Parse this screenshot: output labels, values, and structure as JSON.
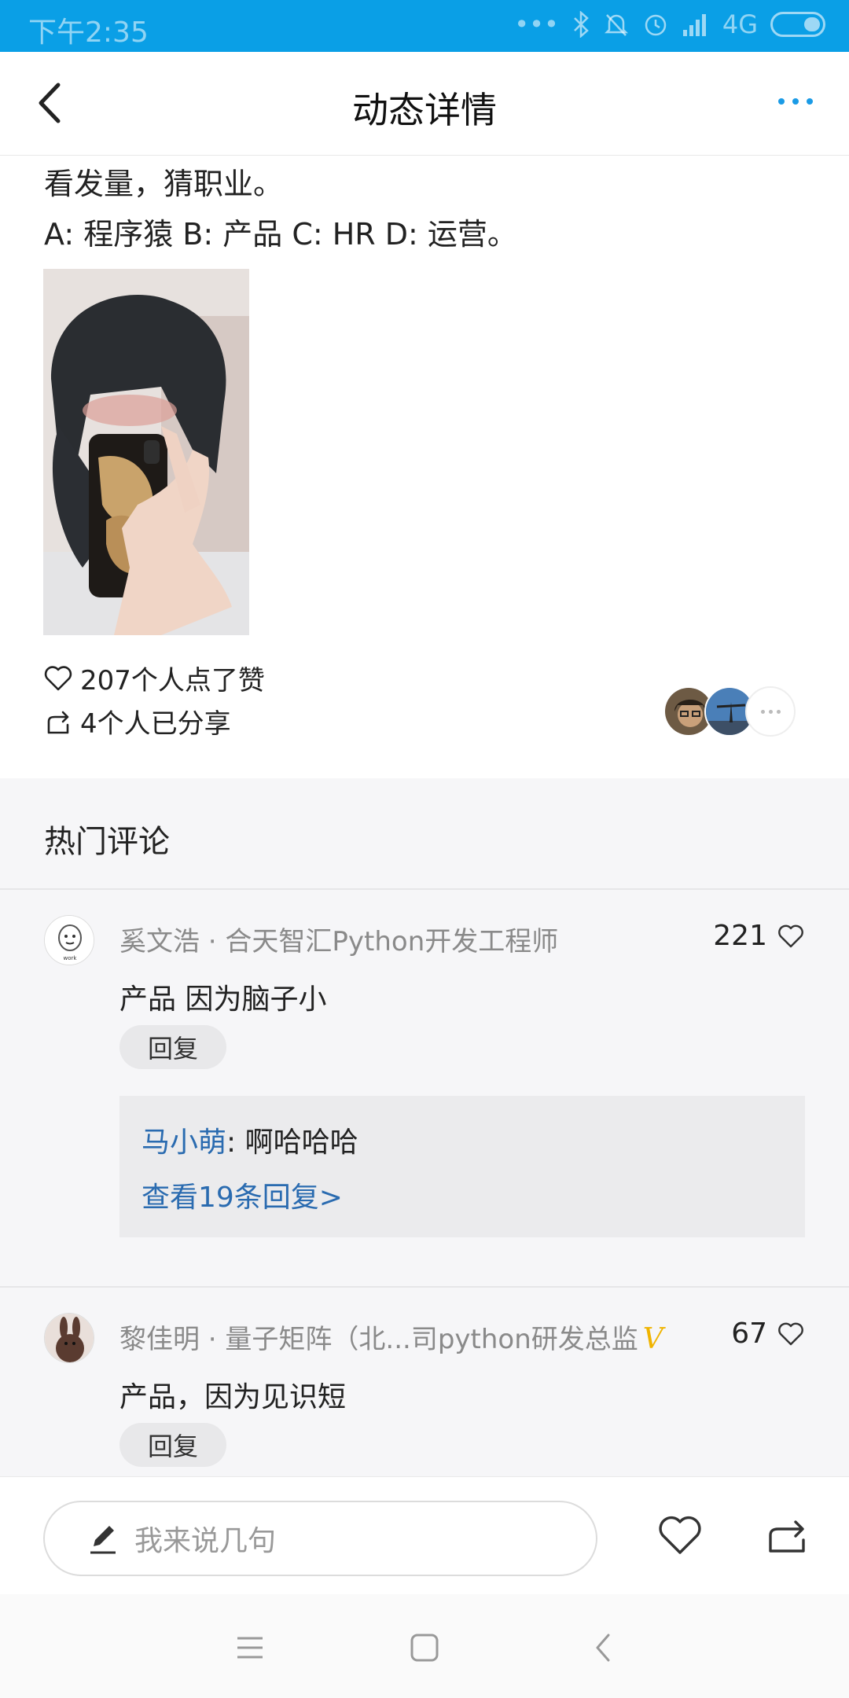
{
  "status_bar": {
    "time": "下午2:35",
    "network": "4G"
  },
  "header": {
    "title": "动态详情"
  },
  "post": {
    "line1": "看发量，猜职业。",
    "line2": "A: 程序猿 B: 产品 C: HR D: 运营。",
    "likes_text": "207个人点了赞",
    "shares_text": "4个人已分享"
  },
  "comments_section": {
    "title": "热门评论",
    "comments": [
      {
        "author": "奚文浩 · 合天智汇Python开发工程师",
        "likes": "221",
        "text": "产品 因为脑子小",
        "reply_label": "回复",
        "reply_preview": {
          "user": "马小萌",
          "text": ": 啊哈哈哈",
          "view_more": "查看19条回复>"
        }
      },
      {
        "author": "黎佳明 · 量子矩阵（北...司python研发总监",
        "badge": "V",
        "likes": "67",
        "text": "产品，因为见识短",
        "reply_label": "回复"
      }
    ]
  },
  "bottom_bar": {
    "input_placeholder": "我来说几句"
  },
  "colors": {
    "status_bar": "#0a9fe6",
    "link_blue": "#2a6bb0",
    "more_dots": "#1a9be6",
    "badge_gold": "#f0b400"
  }
}
